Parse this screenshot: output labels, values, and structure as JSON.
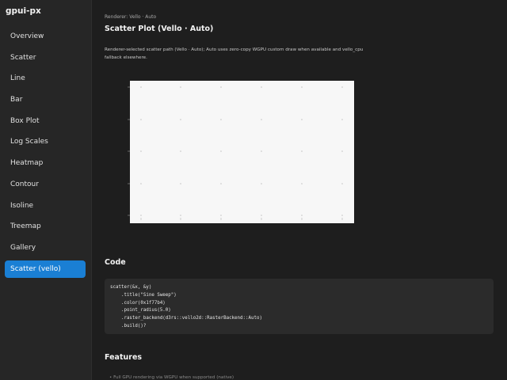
{
  "app": {
    "title": "gpui-px"
  },
  "sidebar": {
    "items": [
      {
        "label": "Overview"
      },
      {
        "label": "Scatter"
      },
      {
        "label": "Line"
      },
      {
        "label": "Bar"
      },
      {
        "label": "Box Plot"
      },
      {
        "label": "Log Scales"
      },
      {
        "label": "Heatmap"
      },
      {
        "label": "Contour"
      },
      {
        "label": "Isoline"
      },
      {
        "label": "Treemap"
      },
      {
        "label": "Gallery"
      },
      {
        "label": "Scatter (vello)"
      }
    ],
    "active_index": 11,
    "active_color": "#1a7fd4"
  },
  "main": {
    "breadcrumb": "Renderer: Vello · Auto",
    "title": "Scatter Plot (Vello · Auto)",
    "description": "Renderer-selected scatter path (Vello · Auto); Auto uses zero-copy WGPU custom draw when available and vello_cpu fallback elsewhere.",
    "plot": {
      "background": "#f7f7f7",
      "grid_dots": "#c4c4c4"
    },
    "code_section_title": "Code",
    "code_lines": [
      "scatter(&x, &y)",
      "    .title(\"Sine Sweep\")",
      "    .color(0x1f77b4)",
      "    .point_radius(5.0)",
      "    .raster_backend(d3rs::vello2d::RasterBackend::Auto)",
      "    .build()?"
    ],
    "features_section_title": "Features",
    "features_first_item": "• Full GPU rendering via WGPU when supported (native)"
  }
}
